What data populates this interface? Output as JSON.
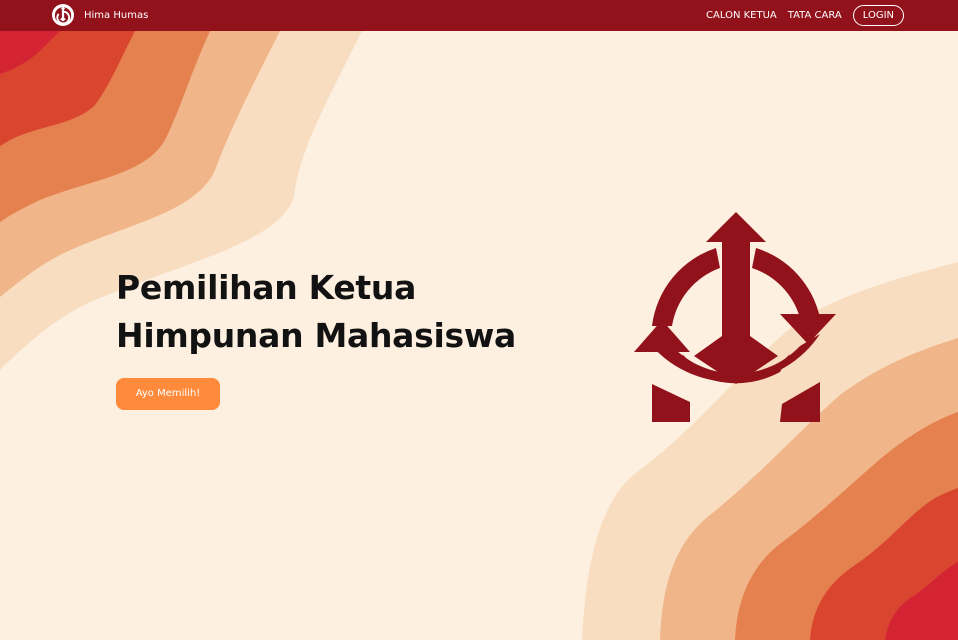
{
  "navbar": {
    "brand_name": "Hima Humas",
    "links": [
      "CALON KETUA",
      "TATA CARA"
    ],
    "login_label": "LOGIN"
  },
  "hero": {
    "title_line1": "Pemilihan Ketua",
    "title_line2": "Himpunan Mahasiswa",
    "cta_label": "Ayo Memilih!"
  },
  "colors": {
    "navbar": "#92121c",
    "background": "#fdf0e1",
    "accent_button": "#ff8a3c",
    "emblem": "#92121c",
    "wave_lightest": "#f8ddc0",
    "wave_light": "#f0b589",
    "wave_mid": "#e5814f",
    "wave_dark": "#d9452f",
    "wave_darkest": "#d42332"
  },
  "icons": {
    "brand_logo": "organization-emblem-icon",
    "hero_emblem": "organization-emblem-icon"
  }
}
